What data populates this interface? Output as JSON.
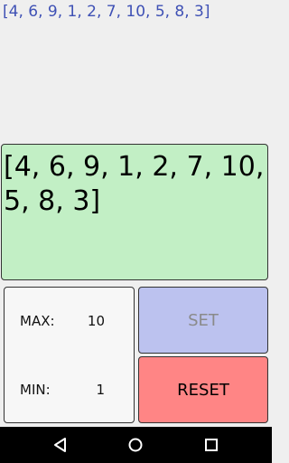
{
  "top_list": "[4, 6, 9, 1, 2, 7, 10, 5, 8, 3]",
  "display": {
    "text": "[4, 6, 9, 1, 2, 7, 10, 5, 8, 3]"
  },
  "settings": {
    "max_label": "MAX:",
    "max_value": "10",
    "min_label": "MIN:",
    "min_value": "1"
  },
  "buttons": {
    "set_label": "SET",
    "reset_label": "RESET"
  },
  "navbar": {
    "icons": [
      "back-icon",
      "home-icon",
      "recent-apps-icon"
    ]
  }
}
